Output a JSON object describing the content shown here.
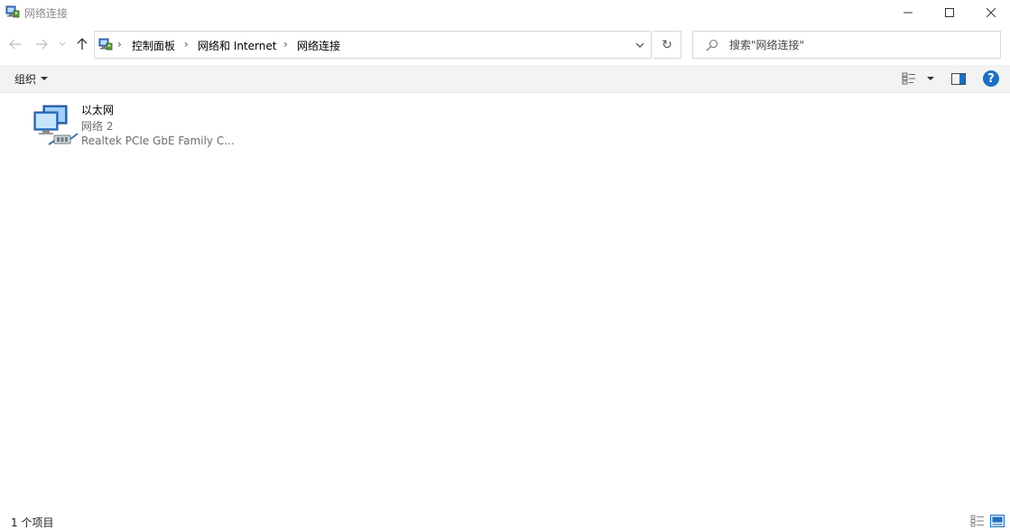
{
  "window": {
    "title": "网络连接",
    "icon": "network-connections-icon"
  },
  "controls": {
    "minimize": "minimize-icon",
    "maximize": "maximize-icon",
    "close": "close-icon"
  },
  "navigation": {
    "back": "back-arrow-icon",
    "forward": "forward-arrow-icon",
    "recent": "chevron-down-icon",
    "up": "up-arrow-icon"
  },
  "breadcrumb": {
    "root_icon": "control-panel-icon",
    "items": [
      {
        "label": "控制面板"
      },
      {
        "label": "网络和 Internet"
      },
      {
        "label": "网络连接"
      }
    ]
  },
  "search": {
    "placeholder": "搜索\"网络连接\""
  },
  "commandbar": {
    "organize_label": "组织"
  },
  "connections": [
    {
      "name": "以太网",
      "network": "网络 2",
      "device": "Realtek PCIe GbE Family C...",
      "icon": "ethernet-adapter-icon"
    }
  ],
  "statusbar": {
    "item_count": "1 个项目"
  },
  "colors": {
    "help_blue": "#1e6fc2",
    "commandbar_bg": "#f3f3f3",
    "secondary_text": "#6d6d6d"
  }
}
